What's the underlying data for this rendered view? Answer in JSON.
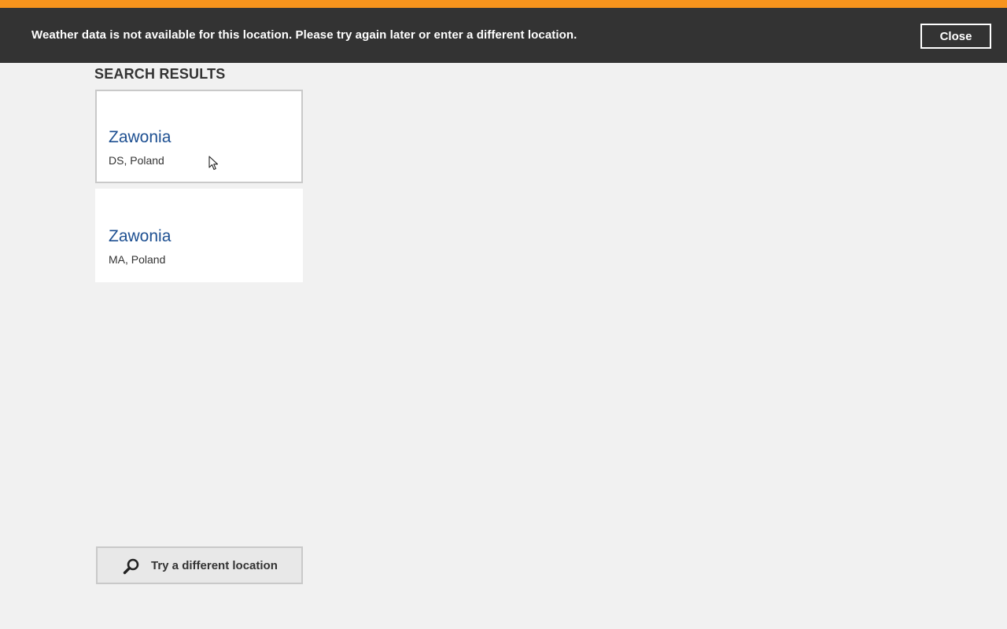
{
  "theme": {
    "accent": "#f7941d",
    "notification_bg": "#333333",
    "page_bg": "#f1f1f1",
    "city_color": "#1d4f91"
  },
  "notification": {
    "message": "Weather data is not available for this location. Please try again later or enter a different location.",
    "close_label": "Close"
  },
  "search_results": {
    "title": "SEARCH RESULTS",
    "items": [
      {
        "city": "Zawonia",
        "region": "DS, Poland",
        "selected": true
      },
      {
        "city": "Zawonia",
        "region": "MA, Poland",
        "selected": false
      }
    ]
  },
  "actions": {
    "try_different_label": "Try a different location",
    "try_different_icon": "search-icon"
  }
}
